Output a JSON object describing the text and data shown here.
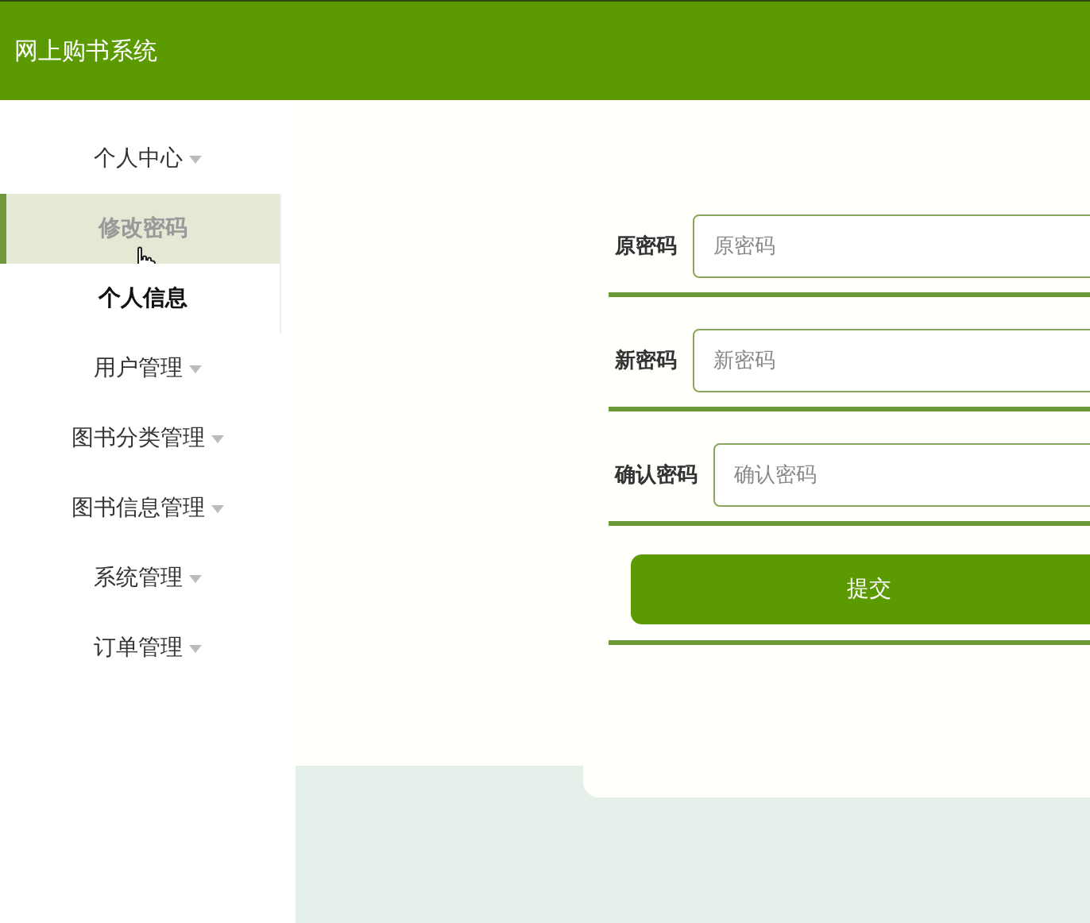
{
  "header": {
    "title": "网上购书系统"
  },
  "menu": [
    {
      "label": "个人中心",
      "expanded": true,
      "children": [
        {
          "label": "修改密码",
          "selected": true
        },
        {
          "label": "个人信息",
          "selected": false
        }
      ]
    },
    {
      "label": "用户管理"
    },
    {
      "label": "图书分类管理"
    },
    {
      "label": "图书信息管理"
    },
    {
      "label": "系统管理"
    },
    {
      "label": "订单管理"
    }
  ],
  "form": {
    "fields": [
      {
        "label": "原密码",
        "placeholder": "原密码"
      },
      {
        "label": "新密码",
        "placeholder": "新密码"
      },
      {
        "label": "确认密码",
        "placeholder": "确认密码"
      }
    ],
    "submit": "提交"
  }
}
